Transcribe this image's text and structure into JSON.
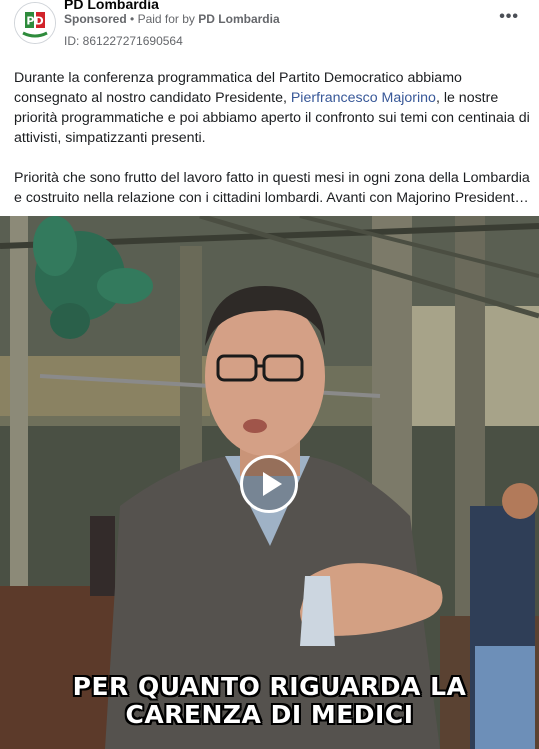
{
  "advertiser": {
    "name": "PD Lombardia",
    "sponsored_label": "Sponsored",
    "separator": "•",
    "paid_for_prefix": "Paid for by",
    "paid_for_name": "PD Lombardia",
    "ad_id": "ID: 861227271690564",
    "logo_text": "PD"
  },
  "menu": {
    "more_label": "•••"
  },
  "post": {
    "p1_before_link": "Durante la conferenza programmatica del Partito Democratico abbiamo consegnato al nostro candidato Presidente, ",
    "p1_link": "Pierfrancesco Majorino",
    "p1_after_link": ", le nostre priorità programmatiche e poi abbiamo aperto il confronto sui temi con centinaia di attivisti, simpatizzanti presenti.",
    "p2": "Priorità che sono frutto del lavoro fatto in questi mesi in ogni zona della Lombardia e costruito nella relazione con i cittadini lombardi. Avanti con Majorino President…"
  },
  "video": {
    "caption_line1": "PER QUANTO RIGUARDA LA",
    "caption_line2": "CARENZA DI MEDICI",
    "play_icon": "play-icon"
  },
  "colors": {
    "link": "#385898",
    "meta": "#65676b",
    "logo_green": "#2e8b3c",
    "logo_red": "#d1232a"
  }
}
